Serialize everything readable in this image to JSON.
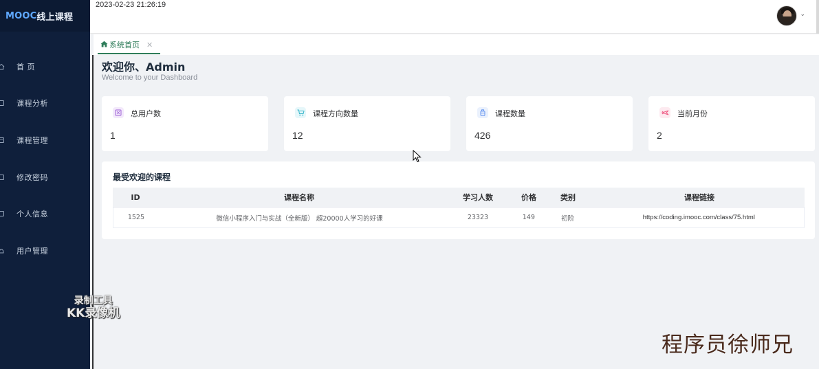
{
  "brand": {
    "part1": "MOOC",
    "part2": "线上课程"
  },
  "sidebar": {
    "items": [
      {
        "label": "首 页",
        "icon": "home-icon"
      },
      {
        "label": "课程分析",
        "icon": "chart-icon"
      },
      {
        "label": "课程管理",
        "icon": "course-icon"
      },
      {
        "label": "修改密码",
        "icon": "lock-icon"
      },
      {
        "label": "个人信息",
        "icon": "user-icon"
      },
      {
        "label": "用户管理",
        "icon": "users-icon"
      }
    ]
  },
  "header": {
    "datetime": "2023-02-23 21:26:19"
  },
  "tabs": [
    {
      "label": "系统首页"
    }
  ],
  "welcome": {
    "title": "欢迎你、Admin",
    "subtitle": "Welcome to your Dashboard"
  },
  "stats": [
    {
      "title": "总用户数",
      "value": "1",
      "icon": "users-icon",
      "color": "#9c5fd6",
      "bg": "#f3e9fb"
    },
    {
      "title": "课程方向数量",
      "value": "12",
      "icon": "cart-icon",
      "color": "#36b5c9",
      "bg": "#e6f7fa"
    },
    {
      "title": "课程数量",
      "value": "426",
      "icon": "bottle-icon",
      "color": "#5b8def",
      "bg": "#eaf1fd"
    },
    {
      "title": "当前月份",
      "value": "2",
      "icon": "plane-icon",
      "color": "#ef5d86",
      "bg": "#fdeaf0"
    }
  ],
  "popular": {
    "title": "最受欢迎的课程",
    "columns": [
      "ID",
      "课程名称",
      "学习人数",
      "价格",
      "类别",
      "课程链接"
    ],
    "rows": [
      [
        "1525",
        "微信小程序入门与实战（全新版） 超20000人学习的好课",
        "23323",
        "149",
        "初阶",
        "https://coding.imooc.com/class/75.html"
      ]
    ]
  },
  "watermarks": {
    "tool_line1": "录制工具",
    "tool_line2": "KK录像机",
    "author": "程序员徐师兄"
  }
}
